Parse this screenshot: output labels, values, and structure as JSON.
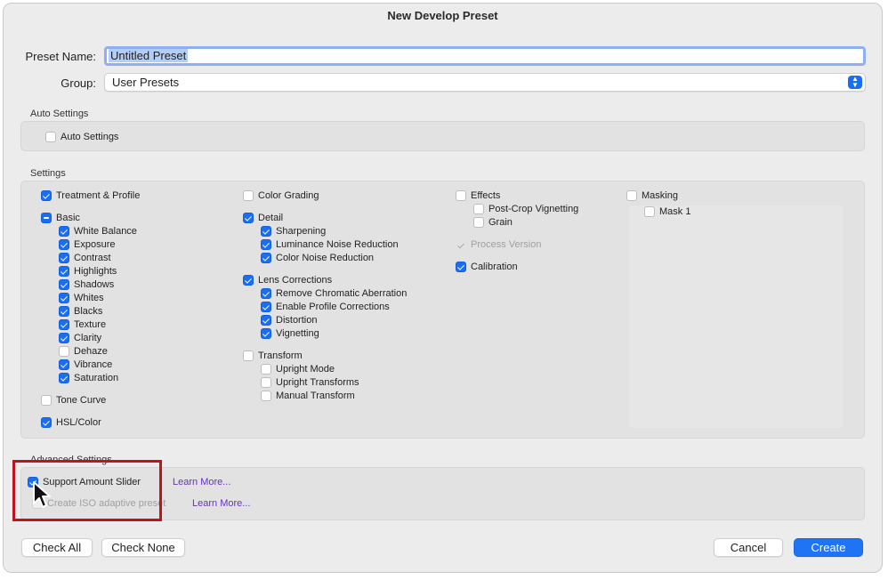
{
  "dialog": {
    "title": "New Develop Preset"
  },
  "preset_name": {
    "label": "Preset Name:",
    "value": "Untitled Preset"
  },
  "group": {
    "label": "Group:",
    "value": "User Presets"
  },
  "auto_settings": {
    "section_title": "Auto Settings",
    "checkbox": {
      "label": "Auto Settings",
      "state": "unchecked"
    }
  },
  "settings": {
    "section_title": "Settings",
    "col1": {
      "treatment": "Treatment & Profile",
      "basic": "Basic",
      "basic_items": [
        "White Balance",
        "Exposure",
        "Contrast",
        "Highlights",
        "Shadows",
        "Whites",
        "Blacks",
        "Texture",
        "Clarity",
        "Dehaze",
        "Vibrance",
        "Saturation"
      ],
      "tone_curve": "Tone Curve",
      "hsl": "HSL/Color"
    },
    "col2": {
      "color_grading": "Color Grading",
      "detail": "Detail",
      "detail_items": [
        "Sharpening",
        "Luminance Noise Reduction",
        "Color Noise Reduction"
      ],
      "lens": "Lens Corrections",
      "lens_items": [
        "Remove Chromatic Aberration",
        "Enable Profile Corrections",
        "Distortion",
        "Vignetting"
      ],
      "transform": "Transform",
      "transform_items": [
        "Upright Mode",
        "Upright Transforms",
        "Manual Transform"
      ]
    },
    "col3": {
      "effects": "Effects",
      "effects_items": [
        "Post-Crop Vignetting",
        "Grain"
      ],
      "process_version": "Process Version",
      "calibration": "Calibration"
    },
    "col4": {
      "masking": "Masking",
      "masking_items": [
        "Mask 1"
      ]
    }
  },
  "advanced": {
    "section_title": "Advanced Settings",
    "support_amount_slider": "Support Amount Slider",
    "iso_adaptive": "Create ISO adaptive preset",
    "learn_more_1": "Learn More...",
    "learn_more_2": "Learn More..."
  },
  "buttons": {
    "check_all": "Check All",
    "check_none": "Check None",
    "cancel": "Cancel",
    "create": "Create"
  },
  "colors": {
    "accent": "#1a6ef5",
    "highlight": "#c0141c",
    "link": "#6b2fc8"
  }
}
